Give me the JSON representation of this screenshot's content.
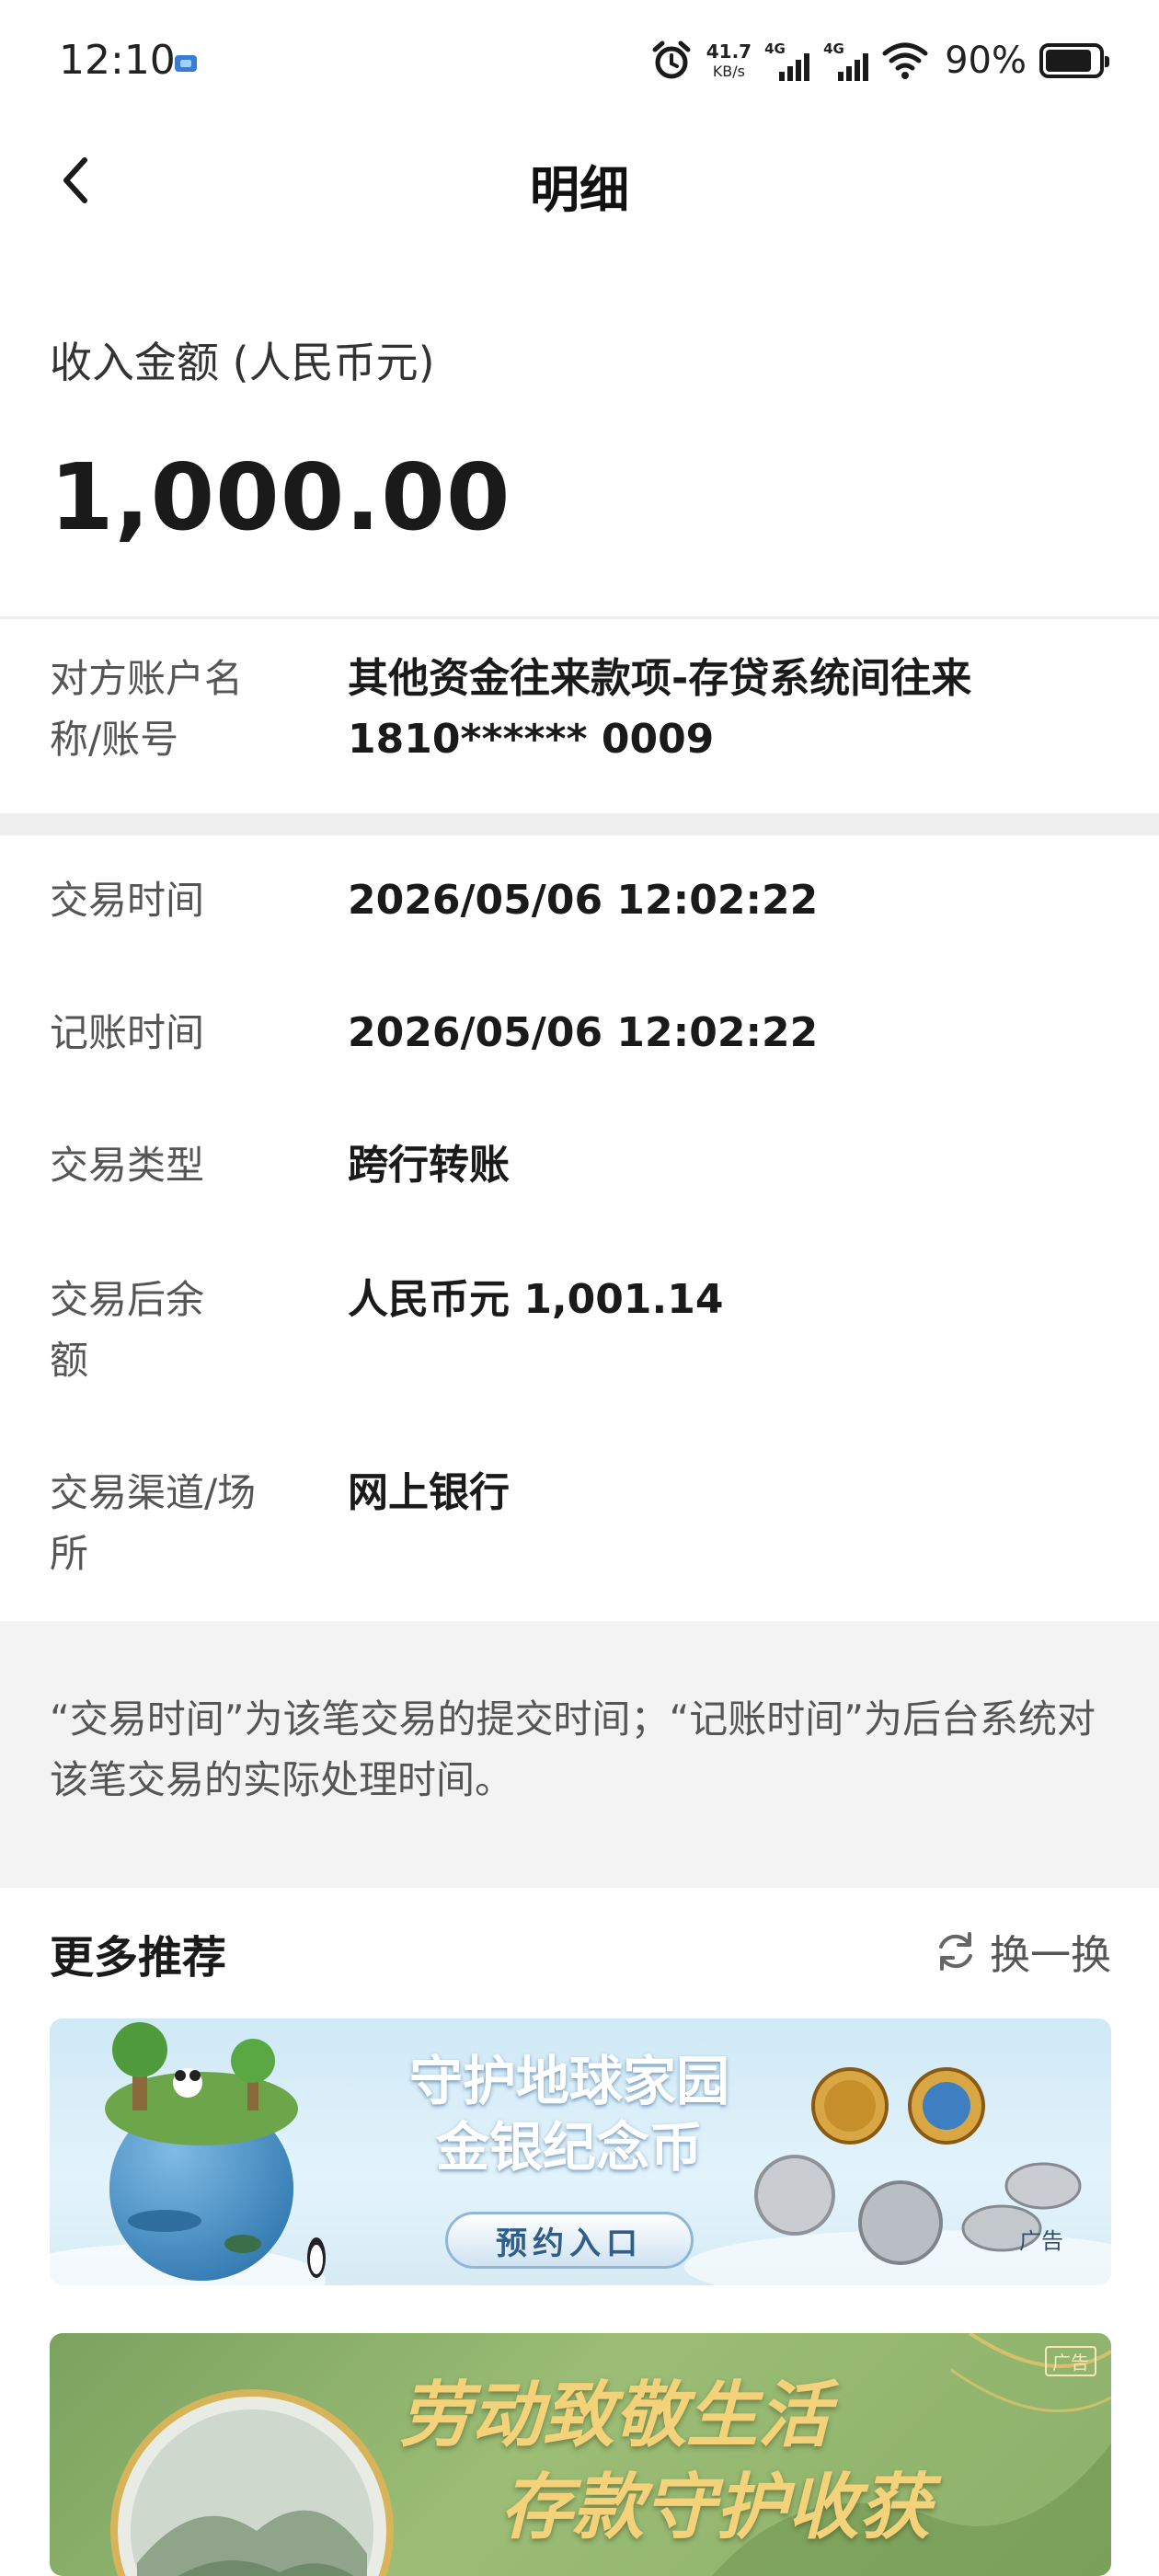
{
  "status_bar": {
    "time": "12:10",
    "net_speed_value": "41.7",
    "net_speed_unit": "KB/s",
    "sim1_tag": "4G",
    "sim2_tag": "4G",
    "battery_percent": "90%",
    "icons": [
      "app-notification-icon",
      "alarm-icon",
      "signal-icon",
      "wifi-icon",
      "battery-icon"
    ]
  },
  "nav": {
    "title": "明细",
    "back_icon": "chevron-left-icon"
  },
  "amount": {
    "label": "收入金额 (人民币元)",
    "value": "1,000.00"
  },
  "details": [
    {
      "label": "对方账户名称/账号",
      "value": "其他资金往来款项-存贷系统间往来 1810****** 0009"
    },
    {
      "label": "交易时间",
      "value": "2026/05/06 12:02:22"
    },
    {
      "label": "记账时间",
      "value": "2026/05/06 12:02:22"
    },
    {
      "label": "交易类型",
      "value": "跨行转账"
    },
    {
      "label": "交易后余额",
      "value": "人民币元 1,001.14"
    },
    {
      "label": "交易渠道/场所",
      "value": "网上银行"
    }
  ],
  "notice": "“交易时间”为该笔交易的提交时间；“记账时间”为后台系统对该笔交易的实际处理时间。",
  "recommend": {
    "title": "更多推荐",
    "refresh_label": "换一换",
    "banners": [
      {
        "headline_1": "守护地球家园",
        "headline_2": "金银纪念币",
        "cta": "预约入口",
        "ad_tag": "广告"
      },
      {
        "headline_1": "劳动致敬生活",
        "headline_2": "存款守护收获",
        "ad_tag": "广告"
      }
    ]
  },
  "colors": {
    "text_primary": "#1a1a1a",
    "text_secondary": "#555555",
    "band_gray": "#f3f3f3",
    "banner_gold": "#f3d27a"
  }
}
